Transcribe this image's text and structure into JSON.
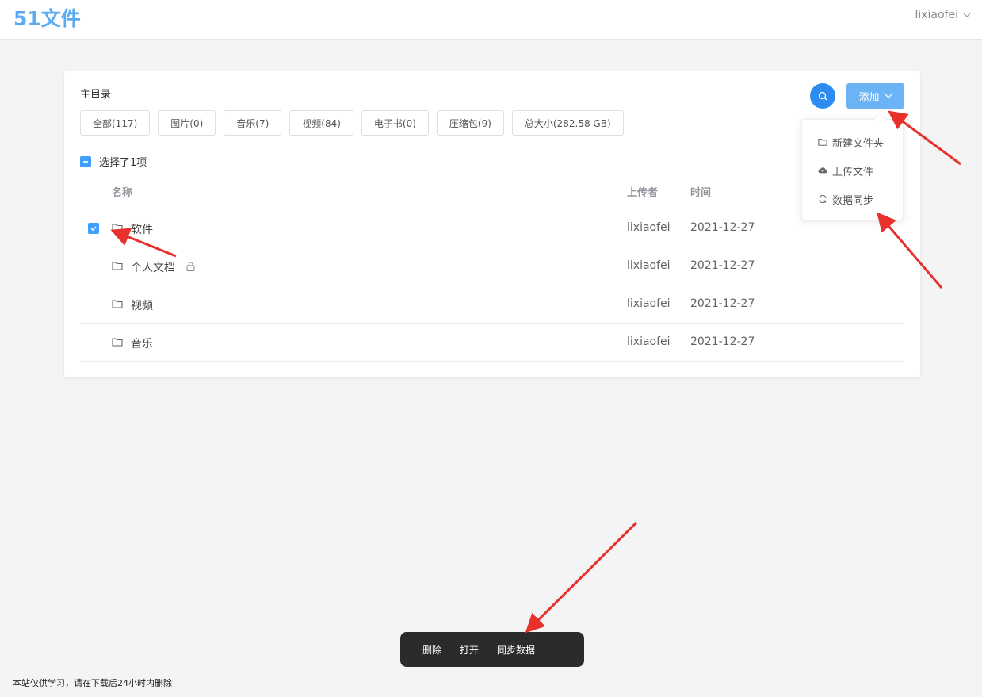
{
  "app": {
    "logo": "51文件",
    "user": "lixiaofei"
  },
  "breadcrumb": "主目录",
  "filters": [
    "全部(117)",
    "图片(0)",
    "音乐(7)",
    "视频(84)",
    "电子书(0)",
    "压缩包(9)",
    "总大小(282.58 GB)"
  ],
  "toolbar": {
    "add_label": "添加"
  },
  "selection": {
    "text": "选择了1项"
  },
  "table": {
    "headers": {
      "name": "名称",
      "uploader": "上传者",
      "time": "时间"
    },
    "rows": [
      {
        "name": "软件",
        "uploader": "lixiaofei",
        "time": "2021-12-27",
        "checked": true
      },
      {
        "name": "个人文档",
        "uploader": "lixiaofei",
        "time": "2021-12-27",
        "locked": true
      },
      {
        "name": "视频",
        "uploader": "lixiaofei",
        "time": "2021-12-27"
      },
      {
        "name": "音乐",
        "uploader": "lixiaofei",
        "time": "2021-12-27"
      }
    ]
  },
  "add_menu": {
    "items": [
      "新建文件夹",
      "上传文件",
      "数据同步"
    ]
  },
  "action_bar": {
    "delete": "删除",
    "open": "打开",
    "sync": "同步数据"
  },
  "footer": "本站仅供学习，请在下载后24小时内删除",
  "colors": {
    "primary": "#409eff",
    "logo": "#5aabf2",
    "annotation_arrow": "#e8302c"
  }
}
